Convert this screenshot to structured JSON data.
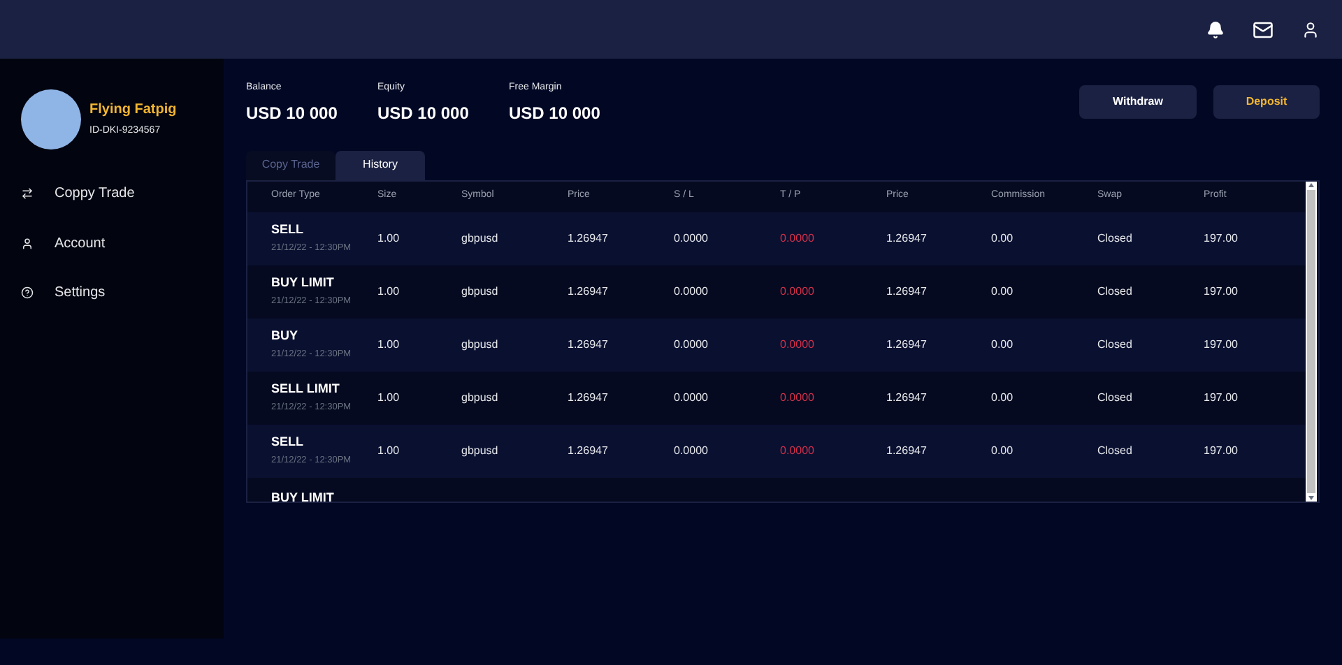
{
  "profile": {
    "name": "Flying Fatpig",
    "id": "ID-DKI-9234567"
  },
  "nav": [
    {
      "label": "Coppy Trade"
    },
    {
      "label": "Account"
    },
    {
      "label": "Settings"
    }
  ],
  "stats": [
    {
      "label": "Balance",
      "value": "USD 10 000"
    },
    {
      "label": "Equity",
      "value": "USD 10 000"
    },
    {
      "label": "Free Margin",
      "value": "USD 10 000"
    }
  ],
  "buttons": [
    {
      "label": "Withdraw",
      "kind": "plain"
    },
    {
      "label": "Deposit",
      "kind": "accent"
    }
  ],
  "tabs": [
    {
      "label": "Copy Trade",
      "selected": false
    },
    {
      "label": "History",
      "selected": true
    }
  ],
  "table": {
    "columns": [
      "Order Type",
      "Size",
      "Symbol",
      "Price",
      "S / L",
      "T / P",
      "Price",
      "Commission",
      "Swap",
      "Profit"
    ],
    "rows": [
      {
        "order_type": "SELL",
        "time": "21/12/22 - 12:30PM",
        "cells": [
          "1.00",
          "gbpusd",
          "1.26947",
          "0.0000",
          "0.0000",
          "1.26947",
          "0.00",
          "Closed",
          "197.00"
        ]
      },
      {
        "order_type": "BUY LIMIT",
        "time": "21/12/22 - 12:30PM",
        "cells": [
          "1.00",
          "gbpusd",
          "1.26947",
          "0.0000",
          "0.0000",
          "1.26947",
          "0.00",
          "Closed",
          "197.00"
        ]
      },
      {
        "order_type": "BUY",
        "time": "21/12/22 - 12:30PM",
        "cells": [
          "1.00",
          "gbpusd",
          "1.26947",
          "0.0000",
          "0.0000",
          "1.26947",
          "0.00",
          "Closed",
          "197.00"
        ]
      },
      {
        "order_type": "SELL LIMIT",
        "time": "21/12/22 - 12:30PM",
        "cells": [
          "1.00",
          "gbpusd",
          "1.26947",
          "0.0000",
          "0.0000",
          "1.26947",
          "0.00",
          "Closed",
          "197.00"
        ]
      },
      {
        "order_type": "SELL",
        "time": "21/12/22 - 12:30PM",
        "cells": [
          "1.00",
          "gbpusd",
          "1.26947",
          "0.0000",
          "0.0000",
          "1.26947",
          "0.00",
          "Closed",
          "197.00"
        ]
      },
      {
        "order_type": "BUY LIMIT"
      }
    ]
  }
}
